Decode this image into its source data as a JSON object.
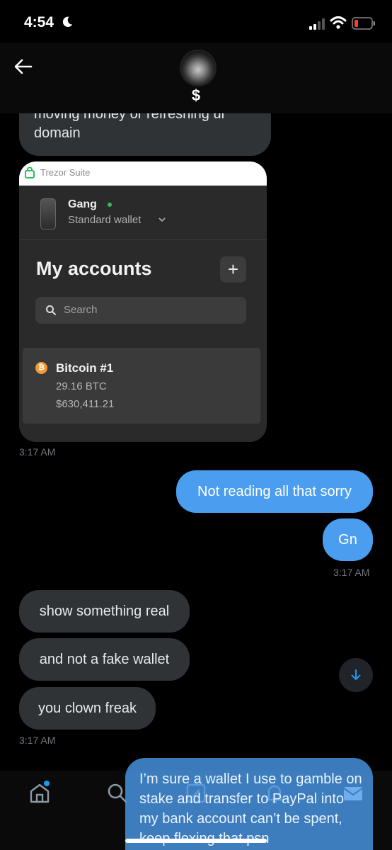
{
  "status_bar": {
    "time": "4:54"
  },
  "header": {
    "handle": "$"
  },
  "messages": {
    "clipped_incoming": "moving money or refreshing ur domain",
    "shared_screenshot": {
      "app_title": "Trezor Suite",
      "wallet_name": "Gang",
      "wallet_type": "Standard wallet",
      "section_title": "My accounts",
      "add_label": "+",
      "search_placeholder": "Search",
      "account": {
        "coin_symbol": "₿",
        "name": "Bitcoin #1",
        "btc": "29.16 BTC",
        "usd": "$630,411.21"
      }
    },
    "ts1": "3:17 AM",
    "out1": "Not reading all that sorry",
    "out2": "Gn",
    "ts2": "3:17 AM",
    "in1": "show something real",
    "in2": "and not a fake wallet",
    "in3": "you clown freak",
    "ts3": "3:17 AM",
    "out3": "I’m sure a wallet I use to gamble on stake and transfer to PayPal into my bank account can’t be spent, keep flexing that psn"
  },
  "colors": {
    "outgoing": "#4b9df0",
    "incoming": "#2f3336",
    "accent": "#1d9bf0"
  }
}
